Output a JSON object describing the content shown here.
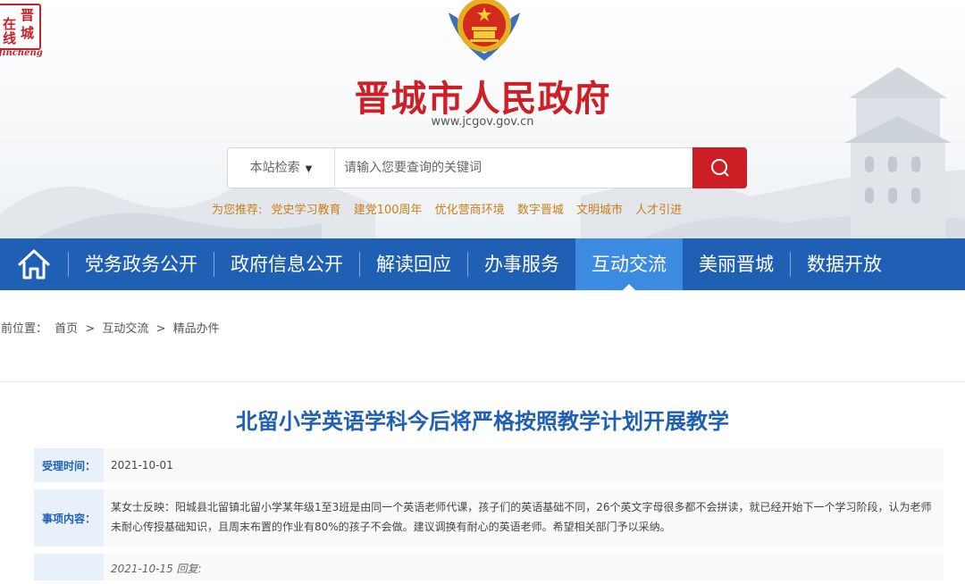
{
  "logo": {
    "chars": [
      "在",
      "晋",
      "线",
      "城"
    ],
    "english": "Jincheng"
  },
  "site": {
    "title": "晋城市人民政府",
    "url": "www.jcgov.gov.cn"
  },
  "search": {
    "scope_label": "本站检索",
    "placeholder": "请输入您要查询的关键词",
    "button_icon": "search-icon"
  },
  "recommend": {
    "label": "为您推荐:",
    "links": [
      "党史学习教育",
      "建党100周年",
      "优化营商环境",
      "数字晋城",
      "文明城市",
      "人才引进"
    ]
  },
  "nav": {
    "home_icon": "home-icon",
    "items": [
      "党务政务公开",
      "政府信息公开",
      "解读回应",
      "办事服务",
      "互动交流",
      "美丽晋城",
      "数据开放"
    ],
    "active": "互动交流"
  },
  "breadcrumb": {
    "prefix": "当前位置：",
    "items": [
      "首页",
      "互动交流",
      "精品办件"
    ],
    "separator": ">"
  },
  "article": {
    "title": "北留小学英语学科今后将严格按照教学计划开展教学",
    "accept_time_label": "受理时间：",
    "accept_time": "2021-10-01",
    "content_label": "事项内容：",
    "content": "某女士反映：阳城县北留镇北留小学某年级1至3班是由同一个英语老师代课，孩子们的英语基础不同，26个英文字母很多都不会拼读，就已经开始下一个学习阶段，认为老师未耐心传授基础知识，且周末布置的作业有80%的孩子不会做。建议调换有耐心的英语老师。希望相关部门予以采纳。",
    "reply_partial": "2021-10-15 回复:"
  },
  "colors": {
    "brand_red": "#cd1f26",
    "nav_blue": "#1f5fb4",
    "nav_active": "#3b8be0",
    "recommend_orange": "#c9811a"
  }
}
